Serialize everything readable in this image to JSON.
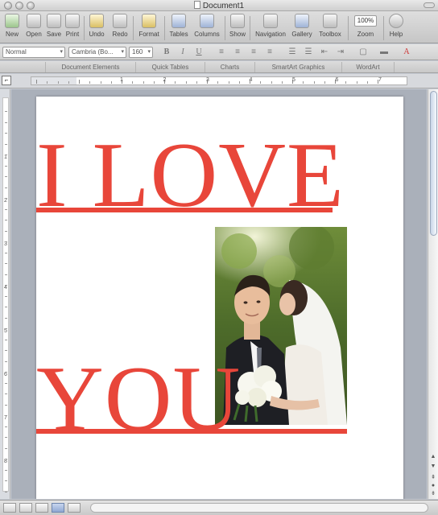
{
  "window": {
    "title": "Document1"
  },
  "toolbar": {
    "items": [
      {
        "label": "New",
        "icon": "new-document-icon"
      },
      {
        "label": "Open",
        "icon": "open-folder-icon"
      },
      {
        "label": "Save",
        "icon": "save-disk-icon"
      },
      {
        "label": "Print",
        "icon": "printer-icon"
      },
      {
        "label": "Undo",
        "icon": "undo-icon"
      },
      {
        "label": "Redo",
        "icon": "redo-icon"
      },
      {
        "label": "Format",
        "icon": "format-brush-icon"
      },
      {
        "label": "Tables",
        "icon": "table-grid-icon"
      },
      {
        "label": "Columns",
        "icon": "columns-icon"
      },
      {
        "label": "Show",
        "icon": "pilcrow-icon"
      },
      {
        "label": "Navigation",
        "icon": "navigation-pane-icon"
      },
      {
        "label": "Gallery",
        "icon": "gallery-icon"
      },
      {
        "label": "Toolbox",
        "icon": "toolbox-icon"
      },
      {
        "label": "Zoom",
        "icon": "zoom-icon"
      },
      {
        "label": "Help",
        "icon": "help-icon"
      }
    ],
    "zoom_value": "100%"
  },
  "format_bar": {
    "style_value": "Normal",
    "font_value": "Cambria (Bo...",
    "size_value": "160",
    "bold": "B",
    "italic": "I",
    "underline": "U",
    "pilcrow": "¶",
    "font_color_letter": "A"
  },
  "ribbon_tabs": [
    "Document Elements",
    "Quick Tables",
    "Charts",
    "SmartArt Graphics",
    "WordArt"
  ],
  "ruler": {
    "h_numbers": [
      "1",
      "2",
      "3",
      "4",
      "5",
      "6",
      "7"
    ],
    "v_numbers": [
      "1",
      "2",
      "3",
      "4",
      "5",
      "6",
      "7",
      "8"
    ]
  },
  "document": {
    "line1": "I LOVE",
    "line2": "YOU",
    "text_color": "#e8463a",
    "photo_description_icon": "wedding-photo-image"
  },
  "colors": {
    "accent": "#e8463a",
    "canvas": "#aab0ba"
  }
}
